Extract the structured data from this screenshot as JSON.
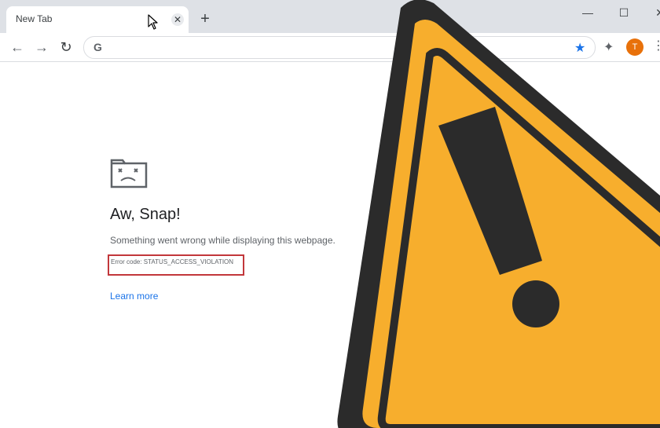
{
  "browser": {
    "tab_title": "New Tab",
    "tab_close": "✕",
    "new_tab": "+",
    "window_controls": {
      "minimize": "—",
      "maximize": "☐",
      "close": "✕"
    },
    "nav": {
      "back": "←",
      "forward": "→",
      "reload": "↻"
    },
    "omnibox": {
      "search_engine_glyph": "G",
      "value": "",
      "bookmark_star": "★"
    },
    "extensions": "✦",
    "avatar_initial": "T",
    "menu": "⋮"
  },
  "page": {
    "heading": "Aw, Snap!",
    "message": "Something went wrong while displaying this webpage.",
    "error_code": "Error code: STATUS_ACCESS_VIOLATION",
    "learn_more": "Learn more"
  },
  "colors": {
    "tabstrip": "#dee1e6",
    "accent_blue": "#1a73e8",
    "error_highlight": "#c2373b",
    "warning_yellow": "#f7ae2d",
    "warning_border": "#2b2b2b",
    "avatar": "#e8710a"
  },
  "icons": {
    "sad_tab": "sad-tab-icon",
    "warning": "warning-triangle-icon",
    "cursor": "mouse-pointer-icon"
  }
}
